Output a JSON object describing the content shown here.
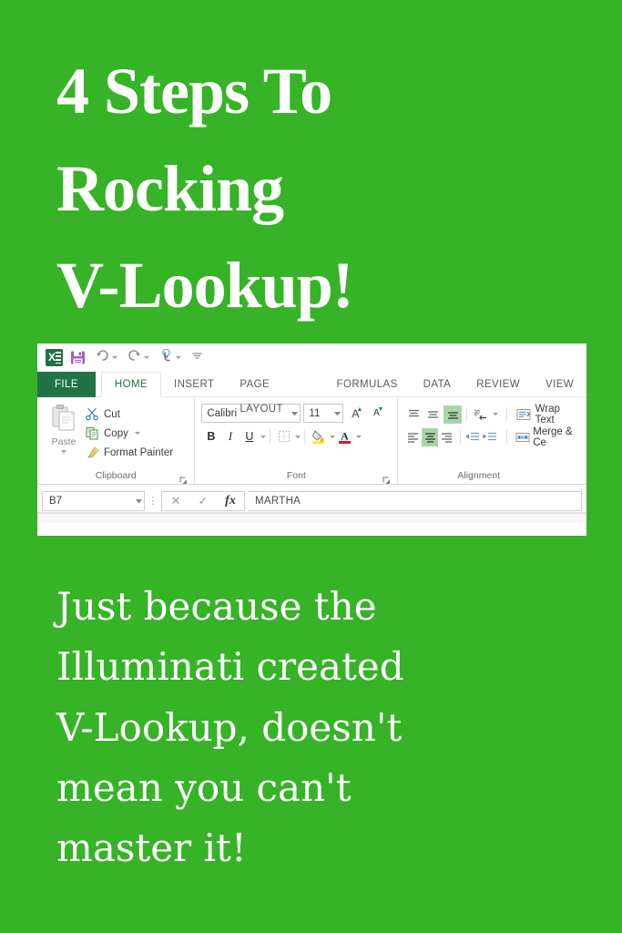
{
  "theme": {
    "background": "#36b327",
    "text_color": "#ffffff",
    "excel_green": "#217346",
    "excel_accent": "#a7d7a8"
  },
  "headline": {
    "lines": [
      "4 Steps To",
      "Rocking",
      "V-Lookup!"
    ]
  },
  "body_copy": {
    "lines": [
      "Just because the",
      "Illuminati  created",
      "V-Lookup, doesn't",
      "mean you can't",
      "master it!"
    ]
  },
  "excel": {
    "quick_access": {
      "app_icon": "excel-logo-icon",
      "items": [
        {
          "name": "save-icon",
          "label": "Save"
        },
        {
          "name": "undo-icon",
          "label": "Undo"
        },
        {
          "name": "redo-icon",
          "label": "Redo"
        },
        {
          "name": "touch-mode-icon",
          "label": "Touch/Mouse Mode"
        },
        {
          "name": "customize-quick-access-icon",
          "label": "Customize Quick Access Toolbar"
        }
      ]
    },
    "tabs": [
      {
        "label": "FILE",
        "state": "file"
      },
      {
        "label": "HOME",
        "state": "active"
      },
      {
        "label": "INSERT",
        "state": "normal"
      },
      {
        "label": "PAGE LAYOUT",
        "state": "normal"
      },
      {
        "label": "FORMULAS",
        "state": "normal"
      },
      {
        "label": "DATA",
        "state": "normal"
      },
      {
        "label": "REVIEW",
        "state": "normal"
      },
      {
        "label": "VIEW",
        "state": "normal"
      }
    ],
    "groups": {
      "clipboard": {
        "label": "Clipboard",
        "paste_label": "Paste",
        "buttons": [
          {
            "label": "Cut",
            "icon": "scissors-icon"
          },
          {
            "label": "Copy",
            "icon": "copy-icon"
          },
          {
            "label": "Format Painter",
            "icon": "format-painter-icon"
          }
        ]
      },
      "font": {
        "label": "Font",
        "font_name": "Calibri",
        "font_size": "11",
        "grow_font": "A",
        "shrink_font": "A",
        "bold": "B",
        "italic": "I",
        "underline": "U",
        "borders_icon": "borders-icon",
        "fill_color_icon": "fill-color-icon",
        "font_color_icon": "font-color-icon"
      },
      "alignment": {
        "label": "Alignment",
        "top_align": "align-top-icon",
        "middle_align": "align-middle-icon",
        "bottom_align": "align-bottom-icon",
        "orientation": "orientation-icon",
        "align_left": "align-left-icon",
        "align_center": "align-center-icon",
        "align_right": "align-right-icon",
        "decrease_indent": "decrease-indent-icon",
        "increase_indent": "increase-indent-icon",
        "wrap_text": "Wrap Text",
        "merge_center": "Merge & Ce"
      }
    },
    "formula_bar": {
      "name_box_value": "B7",
      "cancel_icon": "cancel-icon",
      "enter_icon": "enter-check-icon",
      "function_icon": "fx",
      "formula_value": "MARTHA"
    }
  }
}
